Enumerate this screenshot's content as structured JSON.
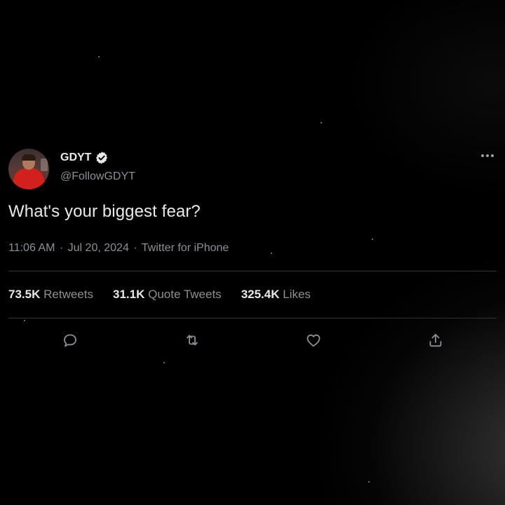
{
  "tweet": {
    "author": {
      "name": "GDYT",
      "handle": "@FollowGDYT",
      "verified": true
    },
    "text": "What's your biggest fear?",
    "meta": {
      "time": "11:06 AM",
      "date": "Jul 20, 2024",
      "source": "Twitter for iPhone",
      "separator": "·"
    },
    "stats": {
      "retweets": {
        "value": "73.5K",
        "label": "Retweets"
      },
      "quote_tweets": {
        "value": "31.1K",
        "label": "Quote Tweets"
      },
      "likes": {
        "value": "325.4K",
        "label": "Likes"
      }
    },
    "actions": [
      {
        "name": "reply",
        "icon": "reply-icon"
      },
      {
        "name": "retweet",
        "icon": "retweet-icon"
      },
      {
        "name": "like",
        "icon": "heart-icon"
      },
      {
        "name": "share",
        "icon": "share-icon"
      }
    ]
  },
  "colors": {
    "background": "#000000",
    "text_primary": "#e7e9ea",
    "text_secondary": "#8b9096",
    "divider": "#2f3336"
  }
}
